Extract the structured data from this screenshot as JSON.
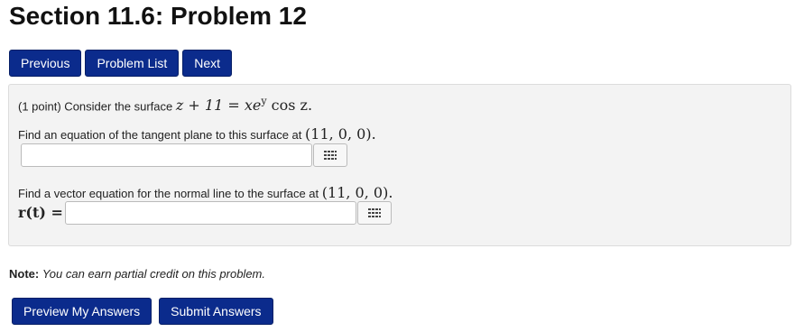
{
  "page": {
    "title": "Section 11.6: Problem 12"
  },
  "nav": {
    "previous": "Previous",
    "problem_list": "Problem List",
    "next": "Next"
  },
  "problem": {
    "points": "(1 point) Consider the surface",
    "equation": "z + 11 = xe",
    "equation_sup": "y",
    "equation_tail": " cos z.",
    "q1_text": "Find an equation of the tangent plane to this surface at",
    "point": "(11, 0, 0).",
    "q2_text": "Find a vector equation for the normal line to the surface at",
    "rt_label": "r(t) ="
  },
  "answers": {
    "answer1_value": "",
    "answer2_value": ""
  },
  "note": {
    "label": "Note:",
    "text": "You can earn partial credit on this problem."
  },
  "actions": {
    "preview": "Preview My Answers",
    "submit": "Submit Answers"
  },
  "colors": {
    "button_bg": "#0b2b8c",
    "panel_bg": "#f3f3f3"
  },
  "icons": [
    "keyboard-grid-icon"
  ]
}
